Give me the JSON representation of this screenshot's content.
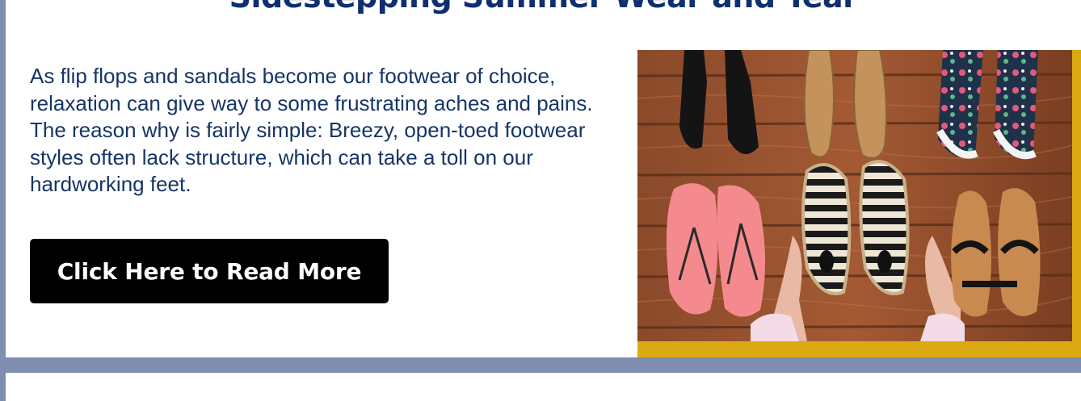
{
  "article": {
    "title": "Sidestepping Summer Wear and Tear",
    "body": "As flip flops and sandals become our footwear of choice, relaxation can give way to some frustrating aches and pains. The reason why is fairly simple: Breezy, open-toed footwear styles often lack structure, which can take a toll on our hardworking feet.",
    "cta_label": "Click Here to Read More"
  },
  "colors": {
    "page_background": "#7f8db0",
    "title": "#0f2f6f",
    "body_text": "#163566",
    "button": "#000000",
    "image_accent": "#dbaa12"
  }
}
